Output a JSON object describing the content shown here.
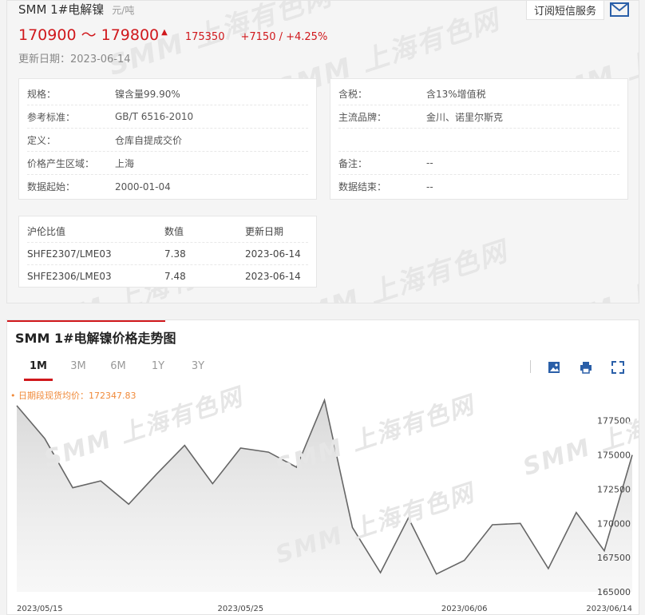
{
  "header": {
    "product_name": "SMM 1#电解镍",
    "unit": "元/吨",
    "subscribe_label": "订阅短信服务",
    "price_range": "170900 ～ 179800",
    "up_arrow": "▲",
    "avg_price": "175350",
    "change": "+7150 / +4.25%",
    "update_date": "更新日期：2023-06-14"
  },
  "colors": {
    "accent": "#d0181c",
    "avg_label": "#f08a3a",
    "line": "#666666"
  },
  "watermark_text": "SMM 上海有色网",
  "specs_left": [
    {
      "key": "规格：",
      "val": "镍含量99.90%"
    },
    {
      "key": "参考标准：",
      "val": "GB/T 6516-2010"
    },
    {
      "key": "定义：",
      "val": "仓库自提成交价"
    },
    {
      "key": "价格产生区域：",
      "val": "上海"
    },
    {
      "key": "数据起始：",
      "val": "2000-01-04"
    }
  ],
  "specs_right": [
    {
      "key": "含税：",
      "val": "含13%增值税"
    },
    {
      "key": "主流品牌：",
      "val": "金川、诺里尔斯克"
    },
    {
      "key": "",
      "val": ""
    },
    {
      "key": "备注：",
      "val": "--"
    },
    {
      "key": "数据结束：",
      "val": "--"
    }
  ],
  "ratio_table": {
    "headers": [
      "沪伦比值",
      "数值",
      "更新日期"
    ],
    "rows": [
      [
        "SHFE2307/LME03",
        "7.38",
        "2023-06-14"
      ],
      [
        "SHFE2306/LME03",
        "7.48",
        "2023-06-14"
      ]
    ]
  },
  "chart_panel": {
    "title": "SMM 1#电解镍价格走势图",
    "tabs": [
      "1M",
      "3M",
      "6M",
      "1Y",
      "3Y"
    ],
    "active_tab": "1M",
    "avg_label": "• 日期段现货均价：172347.83",
    "tools": [
      "save-image-icon",
      "print-icon",
      "fullscreen-icon"
    ]
  },
  "chart_data": {
    "type": "area",
    "title": "",
    "xlabel": "",
    "ylabel": "",
    "x_ticks": [
      "2023/05/15",
      "2023/05/25",
      "2023/06/06",
      "2023/06/14"
    ],
    "y_ticks": [
      165000,
      167500,
      170000,
      172500,
      175000,
      177500
    ],
    "ylim": [
      165000,
      179000
    ],
    "x": [
      "2023/05/15",
      "2023/05/16",
      "2023/05/17",
      "2023/05/18",
      "2023/05/19",
      "2023/05/22",
      "2023/05/23",
      "2023/05/24",
      "2023/05/25",
      "2023/05/26",
      "2023/05/29",
      "2023/05/30",
      "2023/05/31",
      "2023/06/01",
      "2023/06/02",
      "2023/06/05",
      "2023/06/06",
      "2023/06/07",
      "2023/06/08",
      "2023/06/09",
      "2023/06/12",
      "2023/06/13",
      "2023/06/14"
    ],
    "series": [
      {
        "values": [
          178600,
          176200,
          172600,
          173100,
          171400,
          173600,
          175700,
          172900,
          175500,
          175200,
          174100,
          179000,
          169700,
          166400,
          170400,
          166300,
          167300,
          169900,
          170000,
          166700,
          170800,
          168000,
          175000
        ]
      }
    ],
    "grid": false,
    "legend": "none"
  }
}
